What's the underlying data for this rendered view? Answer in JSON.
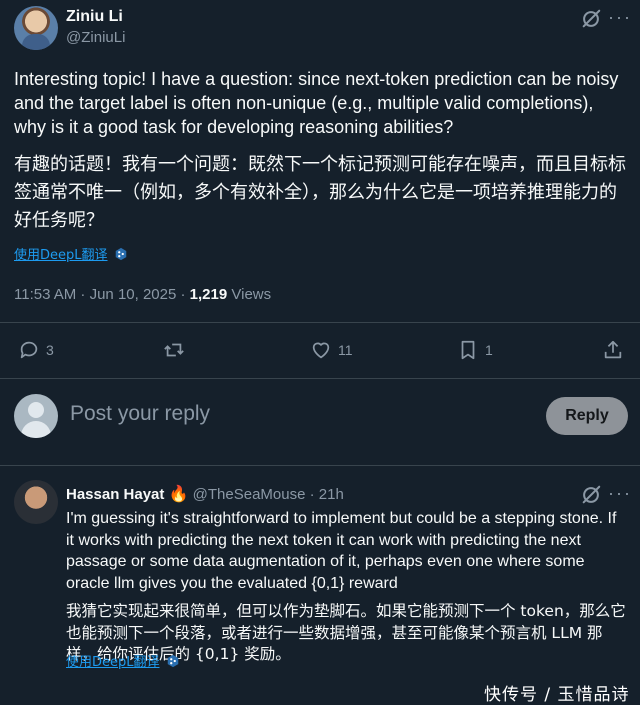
{
  "tweet": {
    "author_name": "Ziniu Li",
    "author_handle": "@ZiniuLi",
    "text_en": "Interesting topic! I have a question: since next-token prediction can be noisy and the target label is often non-unique (e.g., multiple valid completions), why is it  a good task for developing reasoning abilities?",
    "text_zh": "有趣的话题！我有一个问题：既然下一个标记预测可能存在噪声，而且目标标签通常不唯一（例如，多个有效补全），那么为什么它是一项培养推理能力的好任务呢？",
    "translate_label": "使用DeepL翻译",
    "timestamp": "11:53 AM · Jun 10, 2025 · ",
    "views_count": "1,219",
    "views_label": " Views",
    "counts": {
      "replies": "3",
      "retweets": "",
      "likes": "11",
      "bookmarks": "1"
    }
  },
  "composer": {
    "placeholder": "Post your reply",
    "reply_button": "Reply"
  },
  "reply": {
    "author_name": "Hassan Hayat",
    "emoji": "🔥",
    "author_handle": "@TheSeaMouse",
    "time": "· 21h",
    "text_en": "I'm guessing it's straightforward to implement but could be a stepping stone. If it works with predicting the next token it can work with predicting the next passage or some data augmentation of it, perhaps even one where some oracle llm gives you the evaluated {0,1} reward",
    "text_zh": "我猜它实现起来很简单，但可以作为垫脚石。如果它能预测下一个 token，那么它也能预测下一个段落，或者进行一些数据增强，甚至可能像某个预言机 LLM 那样，给你评估后的 {0,1} 奖励。",
    "translate_label": "使用DeepL翻译"
  },
  "watermark": "快传号 / 玉惜品诗",
  "colors": {
    "background": "#15202b",
    "muted": "#8b98a5",
    "link": "#1d9bf0",
    "divider": "#38444d"
  }
}
